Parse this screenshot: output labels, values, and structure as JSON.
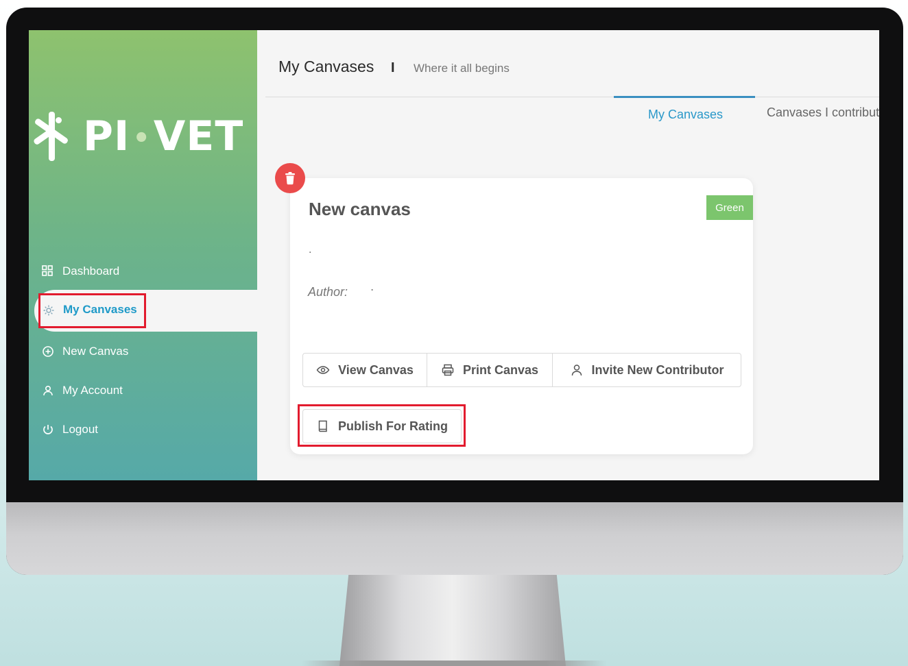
{
  "app": {
    "logo_text_left": "PI",
    "logo_text_right": "VET"
  },
  "sidebar": {
    "items": [
      {
        "label": "Dashboard",
        "icon": "grid-icon"
      },
      {
        "label": "My Canvases",
        "icon": "gear-icon",
        "active": true
      },
      {
        "label": "New Canvas",
        "icon": "plus-circle-icon"
      },
      {
        "label": "My Account",
        "icon": "user-icon"
      },
      {
        "label": "Logout",
        "icon": "power-icon"
      }
    ]
  },
  "header": {
    "title": "My Canvases",
    "separator": "I",
    "subtitle": "Where it all begins"
  },
  "tabs": [
    {
      "label": "My Canvases",
      "active": true
    },
    {
      "label": "Canvases I contribut"
    }
  ],
  "card": {
    "title": "New canvas",
    "badge": "Green",
    "description": ".",
    "author_label": "Author:",
    "author_value": ".",
    "buttons": {
      "view": "View Canvas",
      "print": "Print Canvas",
      "invite": "Invite New Contributor",
      "publish": "Publish For Rating"
    }
  },
  "colors": {
    "accent": "#2a98c9",
    "badge": "#7cc56d",
    "delete": "#ea4b4b",
    "highlight": "#e21b2e"
  }
}
